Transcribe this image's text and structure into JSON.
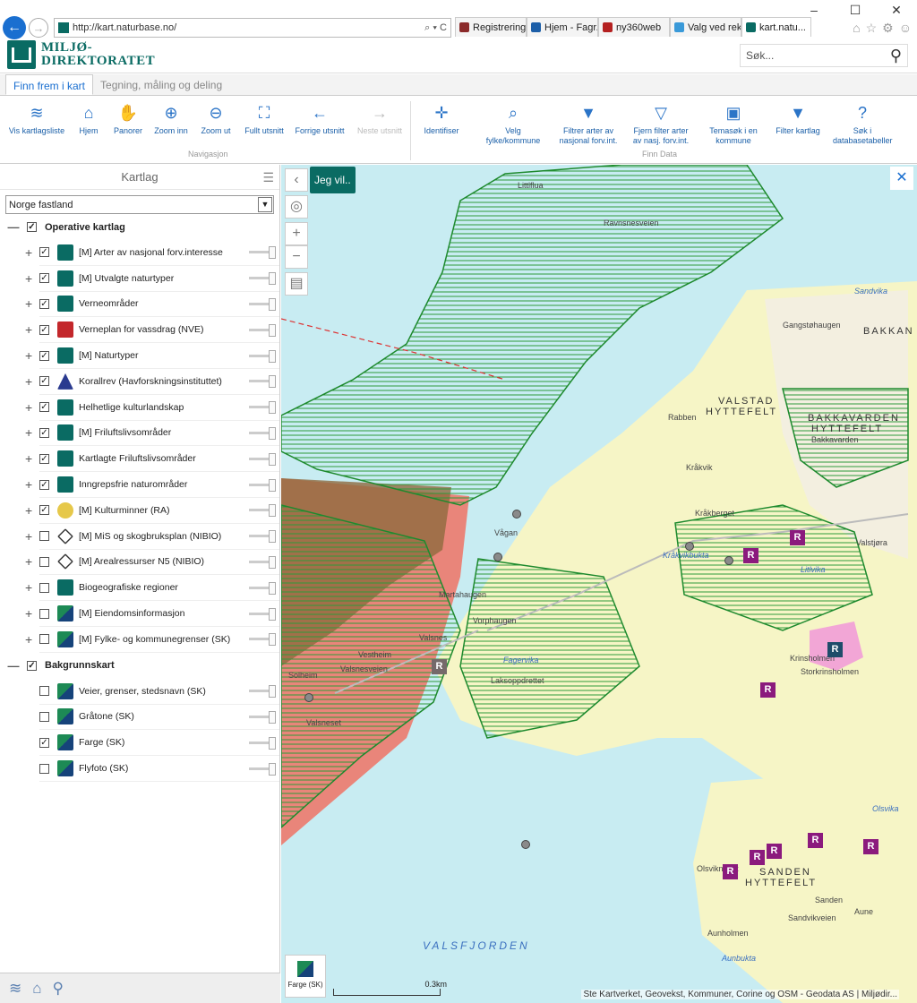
{
  "browser": {
    "url": "http://kart.naturbase.no/",
    "url_icons": "⌕ ▾ C",
    "tabs": [
      {
        "label": "Registrering",
        "color": "#8b2a2a"
      },
      {
        "label": "Hjem - Fagr...",
        "color": "#1d5fa8"
      },
      {
        "label": "ny360web",
        "color": "#b42020"
      },
      {
        "label": "Valg ved rek...",
        "color": "#3a9ad9"
      },
      {
        "label": "kart.natu...",
        "color": "#0a6b63"
      }
    ],
    "window_buttons": [
      "–",
      "☐",
      "✕"
    ],
    "nav_icons": [
      "⌂",
      "☆",
      "⚙",
      "☺"
    ]
  },
  "app": {
    "logo_line1": "MILJØ-",
    "logo_line2": "DIREKTORATET",
    "search_placeholder": "Søk...",
    "ribbon_tabs": [
      "Finn frem i kart",
      "Tegning, måling og deling"
    ]
  },
  "ribbon": {
    "navigation_group": "Navigasjon",
    "finn_data_group": "Finn Data",
    "buttons": [
      {
        "label": "Vis kartlagsliste",
        "icon": "layers-icon",
        "glyph": "≋"
      },
      {
        "label": "Hjem",
        "icon": "home-icon",
        "glyph": "⌂"
      },
      {
        "label": "Panorer",
        "icon": "hand-icon",
        "glyph": "✋"
      },
      {
        "label": "Zoom inn",
        "icon": "zoom-in-icon",
        "glyph": "⊕"
      },
      {
        "label": "Zoom ut",
        "icon": "zoom-out-icon",
        "glyph": "⊖"
      },
      {
        "label": "Fullt utsnitt",
        "icon": "full-extent-icon",
        "glyph": "⛶"
      },
      {
        "label": "Forrige utsnitt",
        "icon": "previous-extent-icon",
        "glyph": "←"
      },
      {
        "label": "Neste utsnitt",
        "icon": "next-extent-icon",
        "glyph": "→"
      },
      {
        "label": "Identifiser",
        "icon": "identify-icon",
        "glyph": "✛"
      },
      {
        "label": "Velg fylke/kommune",
        "icon": "select-region-icon",
        "glyph": "⌕"
      },
      {
        "label": "Filtrer arter av nasjonal forv.int.",
        "icon": "filter-icon",
        "glyph": "▼"
      },
      {
        "label": "Fjern filter arter av nasj. forv.int.",
        "icon": "remove-filter-icon",
        "glyph": "▽"
      },
      {
        "label": "Temasøk i en kommune",
        "icon": "theme-search-icon",
        "glyph": "▣"
      },
      {
        "label": "Filter kartlag",
        "icon": "filter-layer-icon",
        "glyph": "▼"
      },
      {
        "label": "Søk i databasetabeller",
        "icon": "search-database-icon",
        "glyph": "?"
      }
    ]
  },
  "panel": {
    "title": "Kartlag",
    "region": "Norge fastland",
    "operative_group": "Operative kartlag",
    "operative_layers": [
      {
        "label": "[M] Arter av nasjonal forv.interesse",
        "checked": true,
        "icon": "mdir"
      },
      {
        "label": "[M] Utvalgte naturtyper",
        "checked": true,
        "icon": "mdir"
      },
      {
        "label": "Verneområder",
        "checked": true,
        "icon": "mdir"
      },
      {
        "label": "Verneplan for vassdrag (NVE)",
        "checked": true,
        "icon": "nve"
      },
      {
        "label": "[M] Naturtyper",
        "checked": true,
        "icon": "mdir"
      },
      {
        "label": "Korallrev (Havforskningsinstituttet)",
        "checked": true,
        "icon": "havf"
      },
      {
        "label": "Helhetlige kulturlandskap",
        "checked": true,
        "icon": "mdir"
      },
      {
        "label": "[M] Friluftslivsområder",
        "checked": true,
        "icon": "mdir"
      },
      {
        "label": "Kartlagte Friluftslivsområder",
        "checked": true,
        "icon": "mdir"
      },
      {
        "label": "Inngrepsfrie naturområder",
        "checked": true,
        "icon": "mdir"
      },
      {
        "label": "[M] Kulturminner (RA)",
        "checked": true,
        "icon": "ra"
      },
      {
        "label": "[M] MiS og skogbruksplan (NIBIO)",
        "checked": false,
        "icon": "nibio"
      },
      {
        "label": "[M] Arealressurser N5 (NIBIO)",
        "checked": false,
        "icon": "nibio"
      },
      {
        "label": "Biogeografiske regioner",
        "checked": false,
        "icon": "mdir"
      },
      {
        "label": "[M] Eiendomsinformasjon",
        "checked": false,
        "icon": "sk"
      },
      {
        "label": "[M] Fylke- og kommunegrenser (SK)",
        "checked": false,
        "icon": "sk"
      }
    ],
    "background_group": "Bakgrunnskart",
    "background_layers": [
      {
        "label": "Veier, grenser, stedsnavn (SK)",
        "checked": false
      },
      {
        "label": "Gråtone (SK)",
        "checked": false
      },
      {
        "label": "Farge (SK)",
        "checked": true
      },
      {
        "label": "Flyfoto (SK)",
        "checked": false
      }
    ]
  },
  "map": {
    "jeg_vil": "Jeg vil..",
    "basemap_label": "Farge (SK)",
    "scale_label": "0.3km",
    "attribution": "Ste Kartverket, Geovekst, Kommuner, Corine og OSM - Geodata AS | Miljødir...",
    "labels": {
      "l1": "Littlflua",
      "l2": "Gangstøhaugen",
      "l3": "BAKKAN",
      "l4": "VALSTAD",
      "l5": "HYTTEFELT",
      "l6": "BAKKAVARDEN",
      "l7": "HYTTEFELT",
      "l8": "Rabben",
      "l9": "Kråkvik",
      "l10": "Kråkberget",
      "l11": "Vågan",
      "l12": "Martahaugen",
      "l13": "Vorphaugen",
      "l14": "Valsnes",
      "l15": "Vestheim",
      "l16": "Solheim",
      "l17": "Laksoppdrettet",
      "l18": "Valsneset",
      "l19": "Storkrinsholmen",
      "l20": "SANDEN",
      "l21": "HYTTEFELT",
      "l22": "Aunholmen",
      "l23": "Aunbukta",
      "l24": "Olsvikneset",
      "l25": "VALSFJORDEN",
      "l26": "Sandvika",
      "l27": "Olsvika",
      "l28": "Litlvika",
      "l29": "Fagervika",
      "l30": "Kråkvikbukta",
      "l31": "Valstjøra",
      "l32": "Sanden",
      "l33": "Aune",
      "l34": "Bakkavarden",
      "l35": "Krinsholmen",
      "l36": "Ravnsnesveien",
      "l37": "Valsnesveien",
      "l38": "Sandvikveien"
    },
    "marker_letter": "R"
  }
}
